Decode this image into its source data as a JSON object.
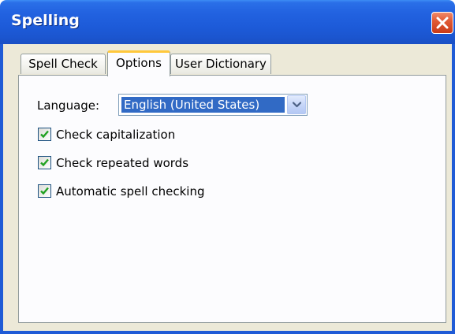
{
  "window": {
    "title": "Spelling",
    "close_icon": "close-icon"
  },
  "tabs": [
    {
      "label": "Spell Check",
      "selected": false
    },
    {
      "label": "Options",
      "selected": true
    },
    {
      "label": "User Dictionary",
      "selected": false
    }
  ],
  "options": {
    "language_label": "Language:",
    "language_value": "English (United States)",
    "checkboxes": [
      {
        "label": "Check capitalization",
        "checked": true
      },
      {
        "label": "Check repeated words",
        "checked": true
      },
      {
        "label": "Automatic spell checking",
        "checked": true
      }
    ]
  },
  "colors": {
    "titlebar": "#2262e0",
    "close_button": "#e15a35",
    "dialog_face": "#ece9d8",
    "selection": "#316ac5",
    "tab_highlight": "#ffc83c",
    "checkmark": "#21a121"
  }
}
